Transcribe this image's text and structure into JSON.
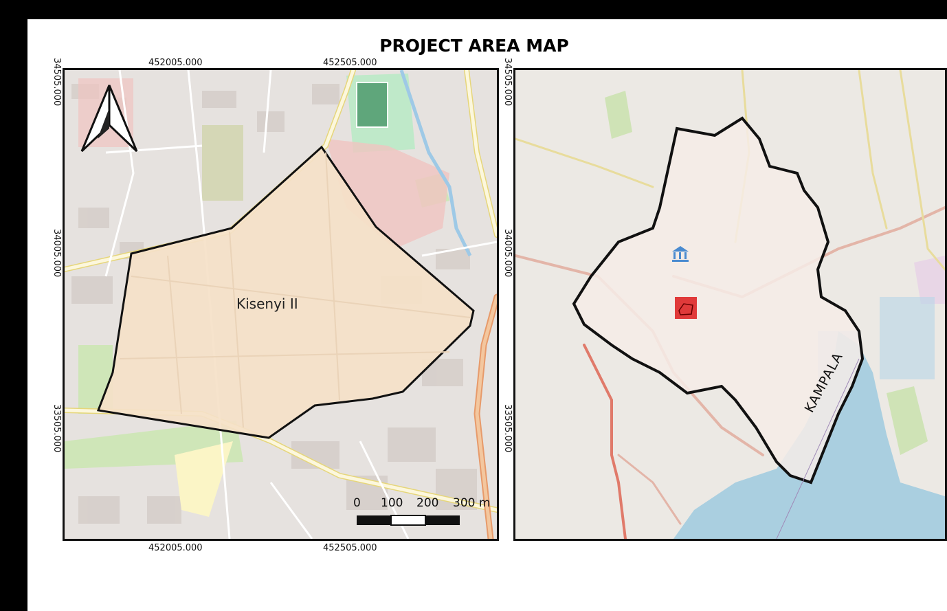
{
  "title": "PROJECT AREA MAP",
  "left_map": {
    "area_label": "Kisenyi II",
    "north_arrow_icon": "north-arrow-icon",
    "top_coords": [
      "452005.000",
      "452505.000"
    ],
    "bottom_coords": [
      "452005.000",
      "452505.000"
    ],
    "left_coords": [
      "34505.000",
      "34005.000",
      "33505.000"
    ],
    "scale_labels": [
      "0",
      "100",
      "200",
      "300 m"
    ],
    "boundary_color": "#111111",
    "area_fill": "#f5e1c8"
  },
  "right_map": {
    "area_label": "KAMPALA",
    "right_coords": [
      "34505.000",
      "34005.000",
      "33505.000"
    ],
    "boundary_color": "#111111",
    "highlight_color": "#e03a3a",
    "lake_color": "#aacfe0",
    "landmark_icon": "museum-icon"
  }
}
